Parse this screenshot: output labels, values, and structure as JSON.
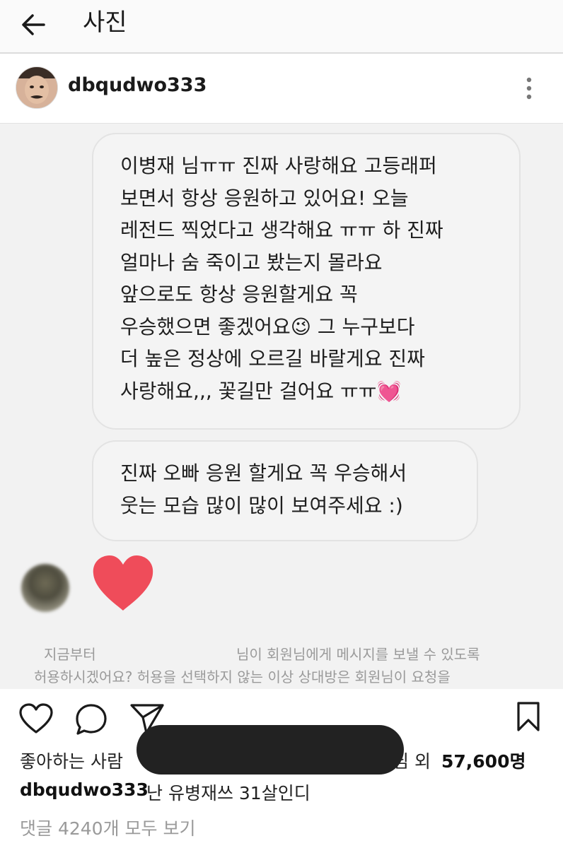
{
  "header": {
    "title": "사진",
    "back_icon": "back-arrow-icon"
  },
  "post": {
    "username": "dbqudwo333",
    "more_icon": "more-vertical-icon"
  },
  "messages": [
    {
      "lines": [
        "이병재 님ㅠㅠ 진짜 사랑해요 고등래퍼",
        "보면서 항상 응원하고 있어요! 오늘",
        "레전드 찍었다고 생각해요 ㅠㅠ 하 진짜",
        "얼마나 숨 죽이고 봤는지 몰라요",
        "앞으로도 항상 응원할게요 꼭",
        "우승했으면 좋겠어요😉 그 누구보다",
        "더 높은 정상에 오르길 바랄게요 진짜",
        "사랑해요,,, 꽃길만 걸어요 ㅠㅠ💓"
      ]
    },
    {
      "lines": [
        "진짜 오빠 응원 할게요 꼭 우승해서",
        "웃는 모습 많이 많이 보여주세요 :)"
      ]
    }
  ],
  "reaction": {
    "icon": "heart-reaction-icon",
    "color": "#ef4c5a"
  },
  "request_prompt": {
    "line1_a": "지금부터",
    "line1_b": "님이 회원님에게 메시지를 보낼 수 있도록",
    "line2": "허용하시겠어요? 허용을 선택하지 않는 이상 상대방은 회원님이 요청을"
  },
  "actions": {
    "like_icon": "heart-outline-icon",
    "comment_icon": "comment-icon",
    "share_icon": "send-icon",
    "save_icon": "bookmark-icon"
  },
  "likes": {
    "prefix": "좋아하는 사람",
    "suffix_pre": "님 외",
    "count": "57,600명"
  },
  "caption": {
    "username": "dbqudwo333",
    "text": "난 유병재쓰 31살인디"
  },
  "comments": {
    "view_all": "댓글 4240개 모두 보기"
  }
}
